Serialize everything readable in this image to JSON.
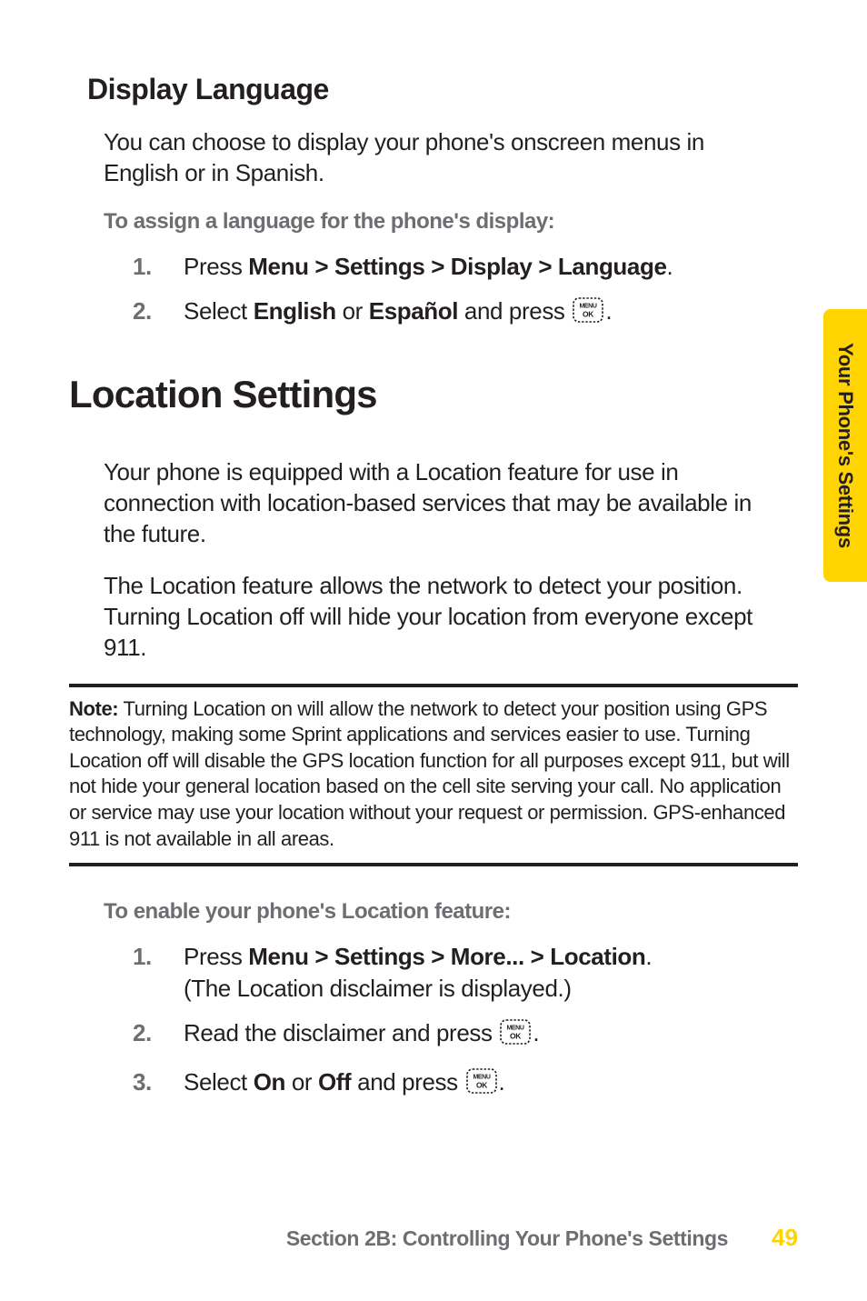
{
  "sideTab": {
    "label": "Your Phone's Settings"
  },
  "section1": {
    "heading": "Display Language",
    "intro": "You can choose to display your phone's onscreen menus in English or in Spanish.",
    "instr": "To assign a language for the phone's display:",
    "steps": {
      "s1_num": "1.",
      "s1_pre": "Press ",
      "s1_path": "Menu > Settings > Display > Language",
      "s1_post": ".",
      "s2_num": "2.",
      "s2_a": "Select ",
      "s2_b": "English",
      "s2_c": " or ",
      "s2_d": "Español",
      "s2_e": " and press ",
      "s2_f": "."
    }
  },
  "section2": {
    "heading": "Location Settings",
    "p1": "Your phone is equipped with a Location feature for use in connection with location-based services that may be available in the future.",
    "p2": "The Location feature allows the network to detect your position. Turning Location off will hide your location from everyone except 911.",
    "note_label": "Note:",
    "note_text": " Turning Location on will allow the network to detect your position using GPS technology, making some Sprint applications and services easier to use. Turning Location off will disable the GPS location function for all purposes except 911, but will not hide your general location based on the cell site serving your call. No application or service may use your location without your request or permission. GPS-enhanced 911 is not available in all areas.",
    "instr": "To enable your phone's Location feature:",
    "steps": {
      "s1_num": "1.",
      "s1_pre": "Press ",
      "s1_path": "Menu > Settings > More... > Location",
      "s1_mid": ". ",
      "s1_par": "(The Location disclaimer is displayed.)",
      "s2_num": "2.",
      "s2_a": "Read the disclaimer and press ",
      "s2_b": ".",
      "s3_num": "3.",
      "s3_a": "Select ",
      "s3_b": "On",
      "s3_c": " or ",
      "s3_d": "Off",
      "s3_e": " and press ",
      "s3_f": "."
    }
  },
  "footer": {
    "text": "Section 2B: Controlling Your Phone's Settings",
    "page": "49"
  },
  "icons": {
    "menu_ok_key": "MENU/OK key"
  }
}
